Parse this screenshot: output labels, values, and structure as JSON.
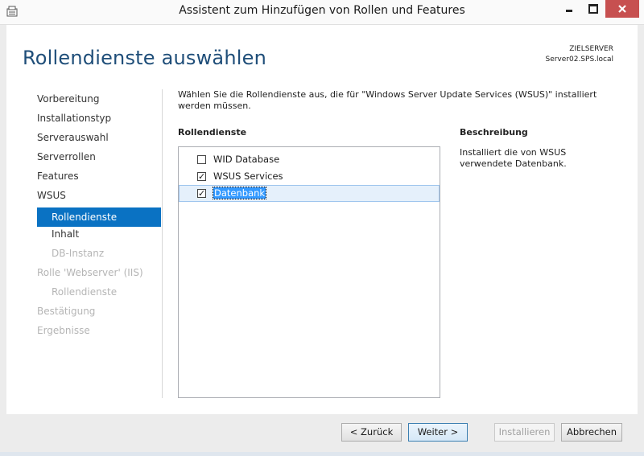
{
  "window": {
    "title": "Assistent zum Hinzufügen von Rollen und Features"
  },
  "header": {
    "page_title": "Rollendienste auswählen",
    "target_label": "ZIELSERVER",
    "target_server": "Server02.SPS.local"
  },
  "nav": {
    "items": [
      {
        "label": "Vorbereitung"
      },
      {
        "label": "Installationstyp"
      },
      {
        "label": "Serverauswahl"
      },
      {
        "label": "Serverrollen"
      },
      {
        "label": "Features"
      },
      {
        "label": "WSUS"
      },
      {
        "label": "Rollendienste"
      },
      {
        "label": "Inhalt"
      },
      {
        "label": "DB-Instanz"
      },
      {
        "label": "Rolle 'Webserver' (IIS)"
      },
      {
        "label": "Rollendienste"
      },
      {
        "label": "Bestätigung"
      },
      {
        "label": "Ergebnisse"
      }
    ]
  },
  "main": {
    "intro": "Wählen Sie die Rollendienste aus, die für \"Windows Server Update Services (WSUS)\" installiert werden müssen.",
    "services_header": "Rollendienste",
    "description_header": "Beschreibung",
    "services": [
      {
        "label": "WID Database",
        "checked": false,
        "check_glyph": ""
      },
      {
        "label": "WSUS Services",
        "checked": true,
        "check_glyph": "✓"
      },
      {
        "label": "Datenbank",
        "checked": true,
        "check_glyph": "✓"
      }
    ],
    "description": "Installiert die von WSUS verwendete Datenbank."
  },
  "footer": {
    "back_label": "< Zurück",
    "next_label": "Weiter >",
    "install_label": "Installieren",
    "cancel_label": "Abbrechen"
  },
  "colors": {
    "accent": "#0a72c3",
    "title_blue": "#1f4e79",
    "close_red": "#c75050"
  },
  "icons": [
    "app-icon",
    "minimize-icon",
    "maximize-icon",
    "close-icon",
    "checkbox-icon"
  ]
}
